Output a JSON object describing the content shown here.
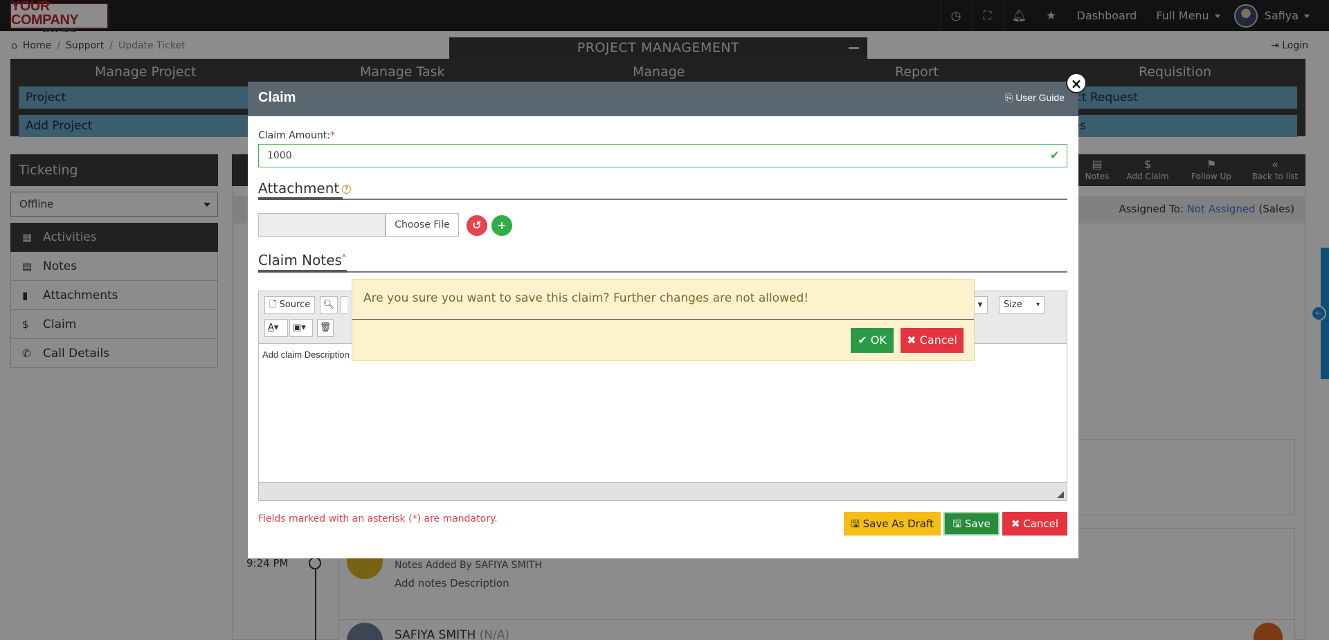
{
  "topbar": {
    "logo_line1": "YOUR COMPANY",
    "logo_line2": "LOGO HERE",
    "dashboard": "Dashboard",
    "full_menu": "Full Menu",
    "user": "Safiya"
  },
  "breadcrumb": {
    "home": "Home",
    "sep1": "/",
    "support": "Support",
    "sep2": "/",
    "current": "Update Ticket"
  },
  "login": "Login",
  "pm": {
    "title": "PROJECT MANAGEMENT",
    "columns": [
      "Manage Project",
      "Manage Task",
      "Manage",
      "Report",
      "Requisition"
    ],
    "project": "Project",
    "add_project": "Add Project",
    "req_request": "ect Request",
    "req_notes": "tes"
  },
  "ticketing": {
    "title": "Ticketing",
    "status": "Offline",
    "items": [
      {
        "icon": "calendar-icon",
        "label": "Activities"
      },
      {
        "icon": "note-icon",
        "label": "Notes"
      },
      {
        "icon": "attachment-icon",
        "label": "Attachments"
      },
      {
        "icon": "dollar-icon",
        "label": "Claim"
      },
      {
        "icon": "phone-icon",
        "label": "Call Details"
      }
    ]
  },
  "toolbar": {
    "notes": "Notes",
    "add_claim": "Add Claim",
    "follow_up": "Follow Up",
    "back": "Back to list"
  },
  "assigned": {
    "label": "Assigned To:",
    "value": "Not Assigned",
    "dept": "(Sales)"
  },
  "timeline": {
    "time": "9:24 PM",
    "notes_added": "Notes Added By SAFIYA SMITH",
    "notes_desc": "Add notes Description",
    "next_user": "SAFIYA SMITH",
    "next_role": "(N/A)"
  },
  "modal": {
    "title": "Claim",
    "user_guide": "User Guide",
    "close": "×",
    "amount_label": "Claim Amount:",
    "required_mark": "*",
    "amount_value": "1000",
    "attachment_title": "Attachment",
    "choose_file": "Choose File",
    "notes_title": "Claim Notes",
    "editor": {
      "source": "Source",
      "size": "Size",
      "placeholder": "Add claim Description"
    },
    "mandatory_note": "Fields marked with an asterisk (*) are mandatory.",
    "save_draft": "Save As Draft",
    "save": "Save",
    "cancel": "Cancel"
  },
  "confirm": {
    "message": "Are you sure you want to save this claim? Further changes are not allowed!",
    "ok": "OK",
    "cancel": "Cancel"
  },
  "colors": {
    "header_dark": "#222222",
    "panel_dark": "#3d3d3d",
    "menu_item": "#6ca9c7",
    "modal_head": "#5b6770",
    "ok_green": "#2a9a47",
    "cancel_red": "#e5343f",
    "draft_yellow": "#f5bd15",
    "confirm_bg": "#fdf2cd"
  }
}
